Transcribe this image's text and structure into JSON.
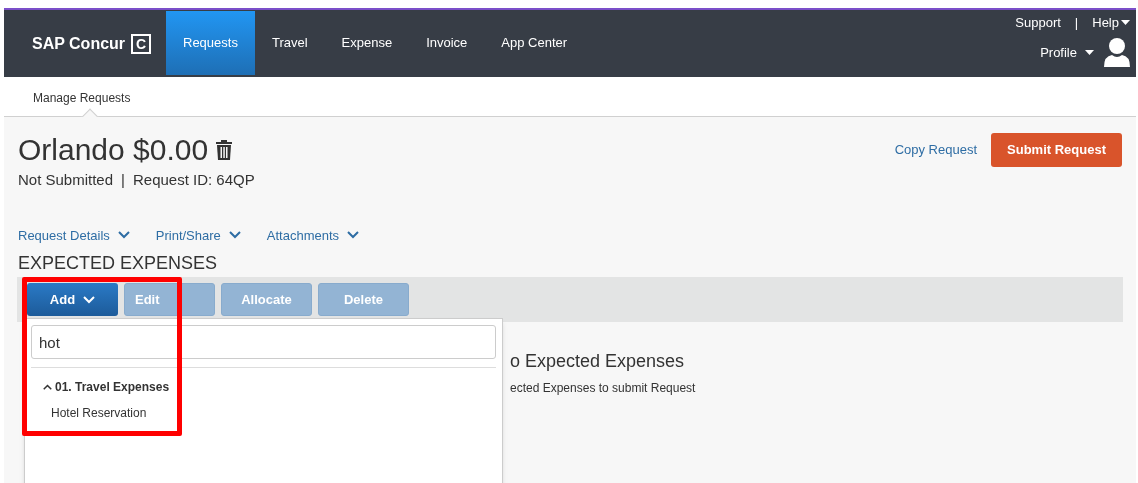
{
  "header": {
    "logo": "SAP Concur",
    "logo_mark": "C",
    "tabs": [
      {
        "label": "Requests",
        "selected": true
      },
      {
        "label": "Travel",
        "selected": false
      },
      {
        "label": "Expense",
        "selected": false
      },
      {
        "label": "Invoice",
        "selected": false
      },
      {
        "label": "App Center",
        "selected": false
      }
    ],
    "support": "Support",
    "separator": "|",
    "help": "Help",
    "profile": "Profile"
  },
  "subnav": {
    "item": "Manage Requests"
  },
  "request": {
    "title": "Orlando $0.00",
    "status": "Not Submitted",
    "separator": "|",
    "request_id": "Request ID: 64QP",
    "copy_link": "Copy Request",
    "submit_button": "Submit Request"
  },
  "menus": [
    "Request Details",
    "Print/Share",
    "Attachments"
  ],
  "section_title": "EXPECTED EXPENSES",
  "toolbar": [
    {
      "label": "Add",
      "disabled": false,
      "kind": "dropdown"
    },
    {
      "label": "Edit",
      "disabled": true,
      "kind": "plain"
    },
    {
      "label": "Allocate",
      "disabled": true,
      "kind": "plain"
    },
    {
      "label": "Delete",
      "disabled": true,
      "kind": "plain"
    }
  ],
  "dropdown": {
    "search_value": "hot",
    "groups": [
      {
        "label": "01. Travel Expenses",
        "expanded": true,
        "items": [
          "Hotel Reservation"
        ]
      }
    ]
  },
  "empty_state": {
    "title": "o Expected Expenses",
    "hint": "ected Expenses to submit Request"
  },
  "highlight": {
    "shown": true
  }
}
